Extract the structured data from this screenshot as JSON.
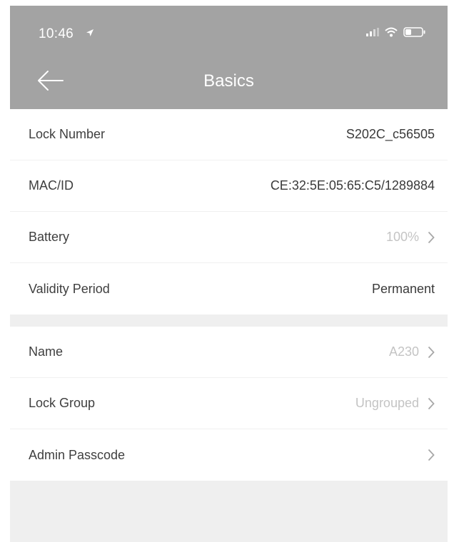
{
  "status_bar": {
    "time": "10:46"
  },
  "nav": {
    "title": "Basics"
  },
  "basics": [
    {
      "label": "Lock Number",
      "value": "S202C_c56505"
    },
    {
      "label": "MAC/ID",
      "value": "CE:32:5E:05:65:C5/1289884"
    },
    {
      "label": "Battery",
      "value": "100%"
    },
    {
      "label": "Validity Period",
      "value": "Permanent"
    }
  ],
  "settings": [
    {
      "label": "Name",
      "value": "A230"
    },
    {
      "label": "Lock Group",
      "value": "Ungrouped"
    },
    {
      "label": "Admin Passcode",
      "value": ""
    }
  ],
  "colors": {
    "header_bg": "#a3a3a3",
    "page_bg": "#efefef",
    "row_bg": "#ffffff",
    "muted_value": "#c4c4c4"
  }
}
